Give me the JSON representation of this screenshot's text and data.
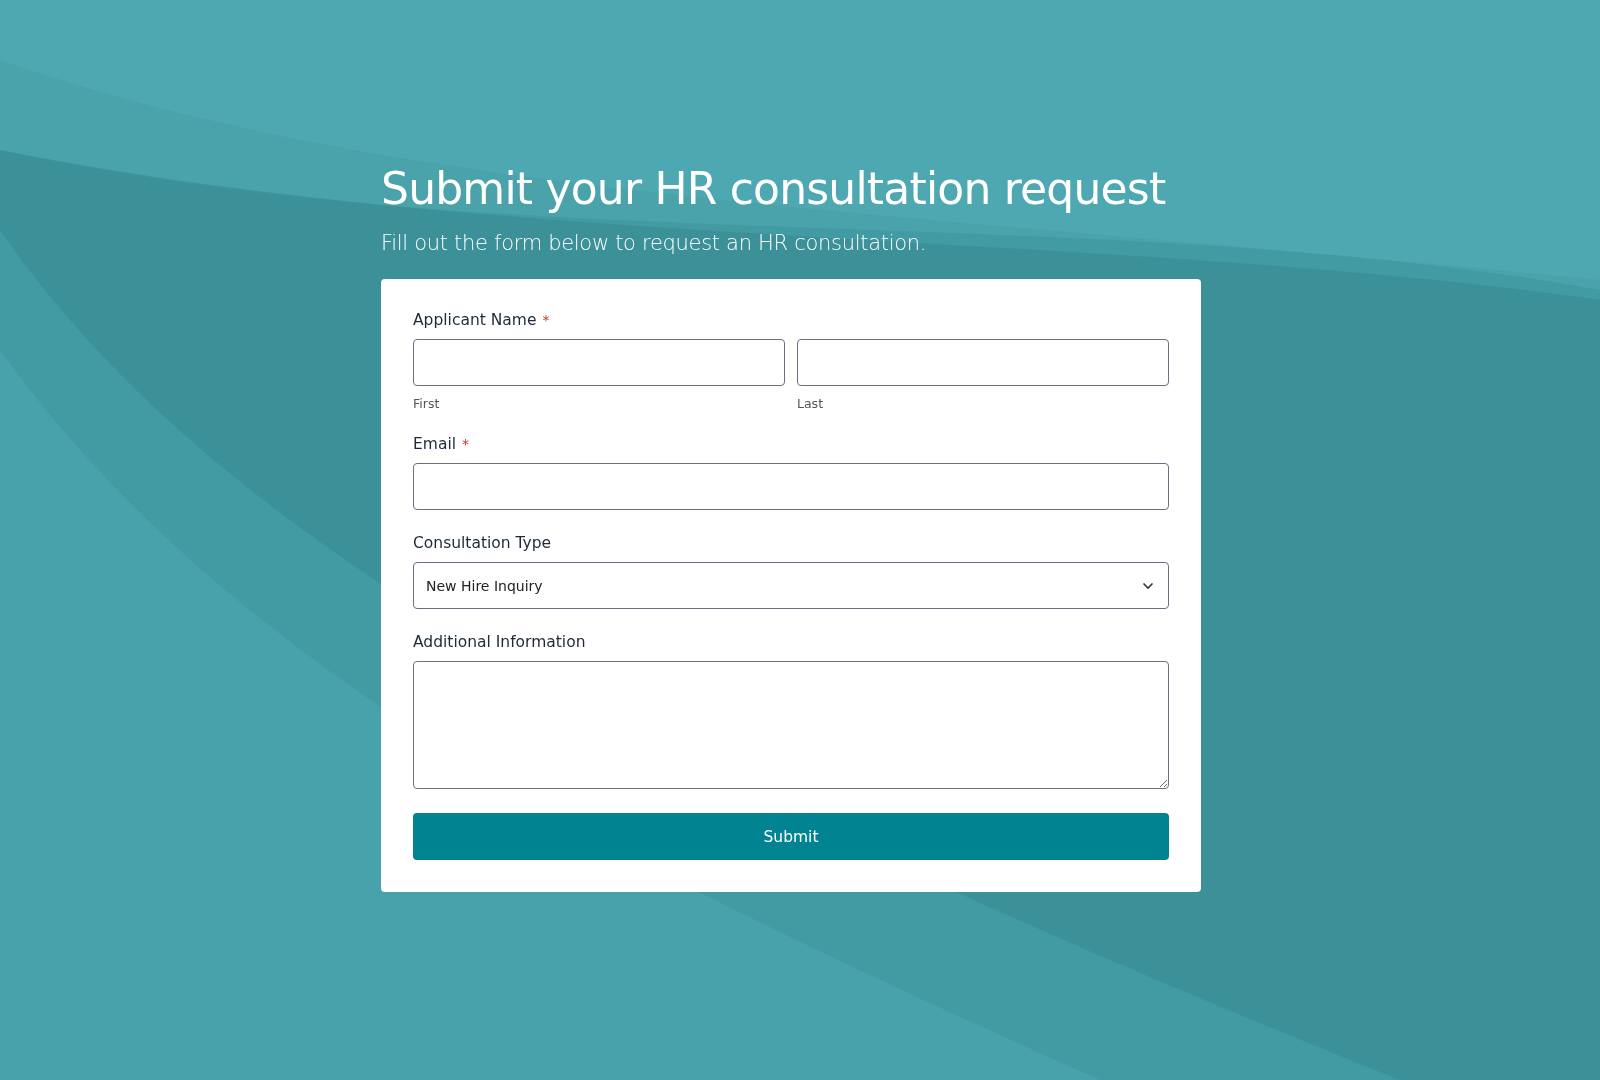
{
  "title": "Submit your HR consultation request",
  "subtitle": "Fill out the form below to request an HR consultation.",
  "form": {
    "required_mark": "*",
    "fields": [
      {
        "kind": "name",
        "label": "Applicant Name",
        "required": true,
        "parts": [
          {
            "sublabel": "First"
          },
          {
            "sublabel": "Last"
          }
        ]
      },
      {
        "kind": "text",
        "label": "Email",
        "required": true
      },
      {
        "kind": "select",
        "label": "Consultation Type",
        "required": false,
        "value": "New Hire Inquiry"
      },
      {
        "kind": "textarea",
        "label": "Additional Information",
        "required": false
      }
    ],
    "submit": "Submit"
  }
}
